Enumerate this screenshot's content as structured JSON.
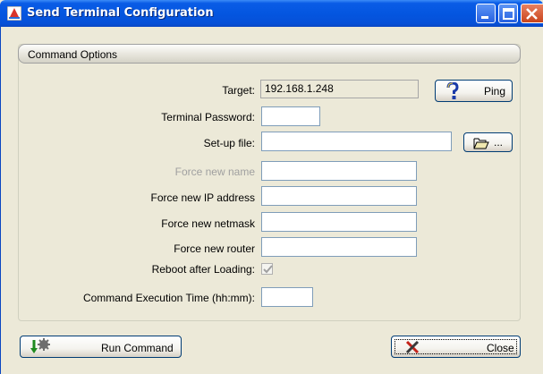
{
  "window": {
    "title": "Send Terminal Configuration"
  },
  "group": {
    "header": "Command Options"
  },
  "form": {
    "target": {
      "label": "Target:",
      "value": "192.168.1.248"
    },
    "password": {
      "label": "Terminal Password:",
      "value": ""
    },
    "setup_file": {
      "label": "Set-up file:",
      "value": ""
    },
    "force_name": {
      "label": "Force new name",
      "value": ""
    },
    "force_ip": {
      "label": "Force new IP address",
      "value": ""
    },
    "force_netmask": {
      "label": "Force new netmask",
      "value": ""
    },
    "force_router": {
      "label": "Force new router",
      "value": ""
    },
    "reboot": {
      "label": "Reboot after Loading:",
      "checked": true
    },
    "exec_time": {
      "label": "Command Execution Time (hh:mm):",
      "value": ""
    }
  },
  "buttons": {
    "ping": "Ping",
    "browse": "...",
    "run": "Run Command",
    "close": "Close"
  }
}
